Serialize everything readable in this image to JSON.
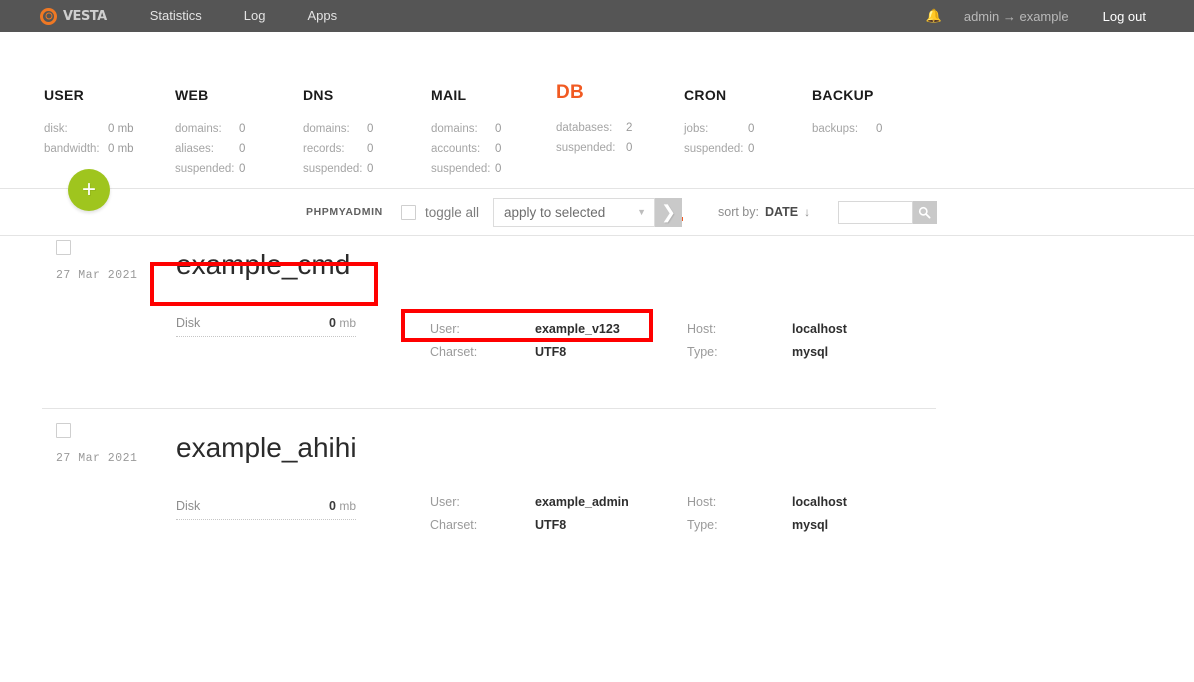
{
  "header": {
    "logo_text": "VESTA",
    "logo_icon": "vesta-ring-icon",
    "nav": [
      {
        "label": "Statistics"
      },
      {
        "label": "Log"
      },
      {
        "label": "Apps"
      }
    ],
    "bell_icon": "bell-icon",
    "user_path": "admin → example",
    "logout_label": "Log out"
  },
  "stats": [
    {
      "title": "USER",
      "active": false,
      "rows": [
        {
          "key": "disk:",
          "value": "0 mb"
        },
        {
          "key": "bandwidth:",
          "value": "0 mb"
        }
      ]
    },
    {
      "title": "WEB",
      "active": false,
      "rows": [
        {
          "key": "domains:",
          "value": "0"
        },
        {
          "key": "aliases:",
          "value": "0"
        },
        {
          "key": "suspended:",
          "value": "0"
        }
      ]
    },
    {
      "title": "DNS",
      "active": false,
      "rows": [
        {
          "key": "domains:",
          "value": "0"
        },
        {
          "key": "records:",
          "value": "0"
        },
        {
          "key": "suspended:",
          "value": "0"
        }
      ]
    },
    {
      "title": "MAIL",
      "active": false,
      "rows": [
        {
          "key": "domains:",
          "value": "0"
        },
        {
          "key": "accounts:",
          "value": "0"
        },
        {
          "key": "suspended:",
          "value": "0"
        }
      ]
    },
    {
      "title": "DB",
      "active": true,
      "rows": [
        {
          "key": "databases:",
          "value": "2"
        },
        {
          "key": "suspended:",
          "value": "0"
        }
      ]
    },
    {
      "title": "CRON",
      "active": false,
      "rows": [
        {
          "key": "jobs:",
          "value": "0"
        },
        {
          "key": "suspended:",
          "value": "0"
        }
      ]
    },
    {
      "title": "BACKUP",
      "active": false,
      "rows": [
        {
          "key": "backups:",
          "value": "0"
        }
      ]
    }
  ],
  "toolbar": {
    "add_label": "+",
    "phpmyadmin_label": "PHPMYADMIN",
    "toggle_all_label": "toggle all",
    "apply_selected_label": "apply to selected",
    "apply_caret_icon": "chevron-down-icon",
    "go_icon": "chevron-right-icon",
    "sort_by_label": "sort by:",
    "sort_by_value": "DATE",
    "sort_direction_icon": "arrow-down-icon",
    "search_value": "",
    "search_placeholder": "",
    "search_icon": "search-icon"
  },
  "databases": [
    {
      "date": "27 Mar 2021",
      "name": "example_cmd",
      "disk_label": "Disk",
      "disk_value": "0",
      "disk_unit": "mb",
      "user_label": "User:",
      "user_value": "example_v123",
      "charset_label": "Charset:",
      "charset_value": "UTF8",
      "host_label": "Host:",
      "host_value": "localhost",
      "type_label": "Type:",
      "type_value": "mysql"
    },
    {
      "date": "27 Mar 2021",
      "name": "example_ahihi",
      "disk_label": "Disk",
      "disk_value": "0",
      "disk_unit": "mb",
      "user_label": "User:",
      "user_value": "example_admin",
      "charset_label": "Charset:",
      "charset_value": "UTF8",
      "host_label": "Host:",
      "host_value": "localhost",
      "type_label": "Type:",
      "type_value": "mysql"
    }
  ],
  "colors": {
    "topbar": "#555555",
    "accent_orange": "#f15a22",
    "add_green": "#9fc51e",
    "annotation_red": "#ff0000"
  }
}
